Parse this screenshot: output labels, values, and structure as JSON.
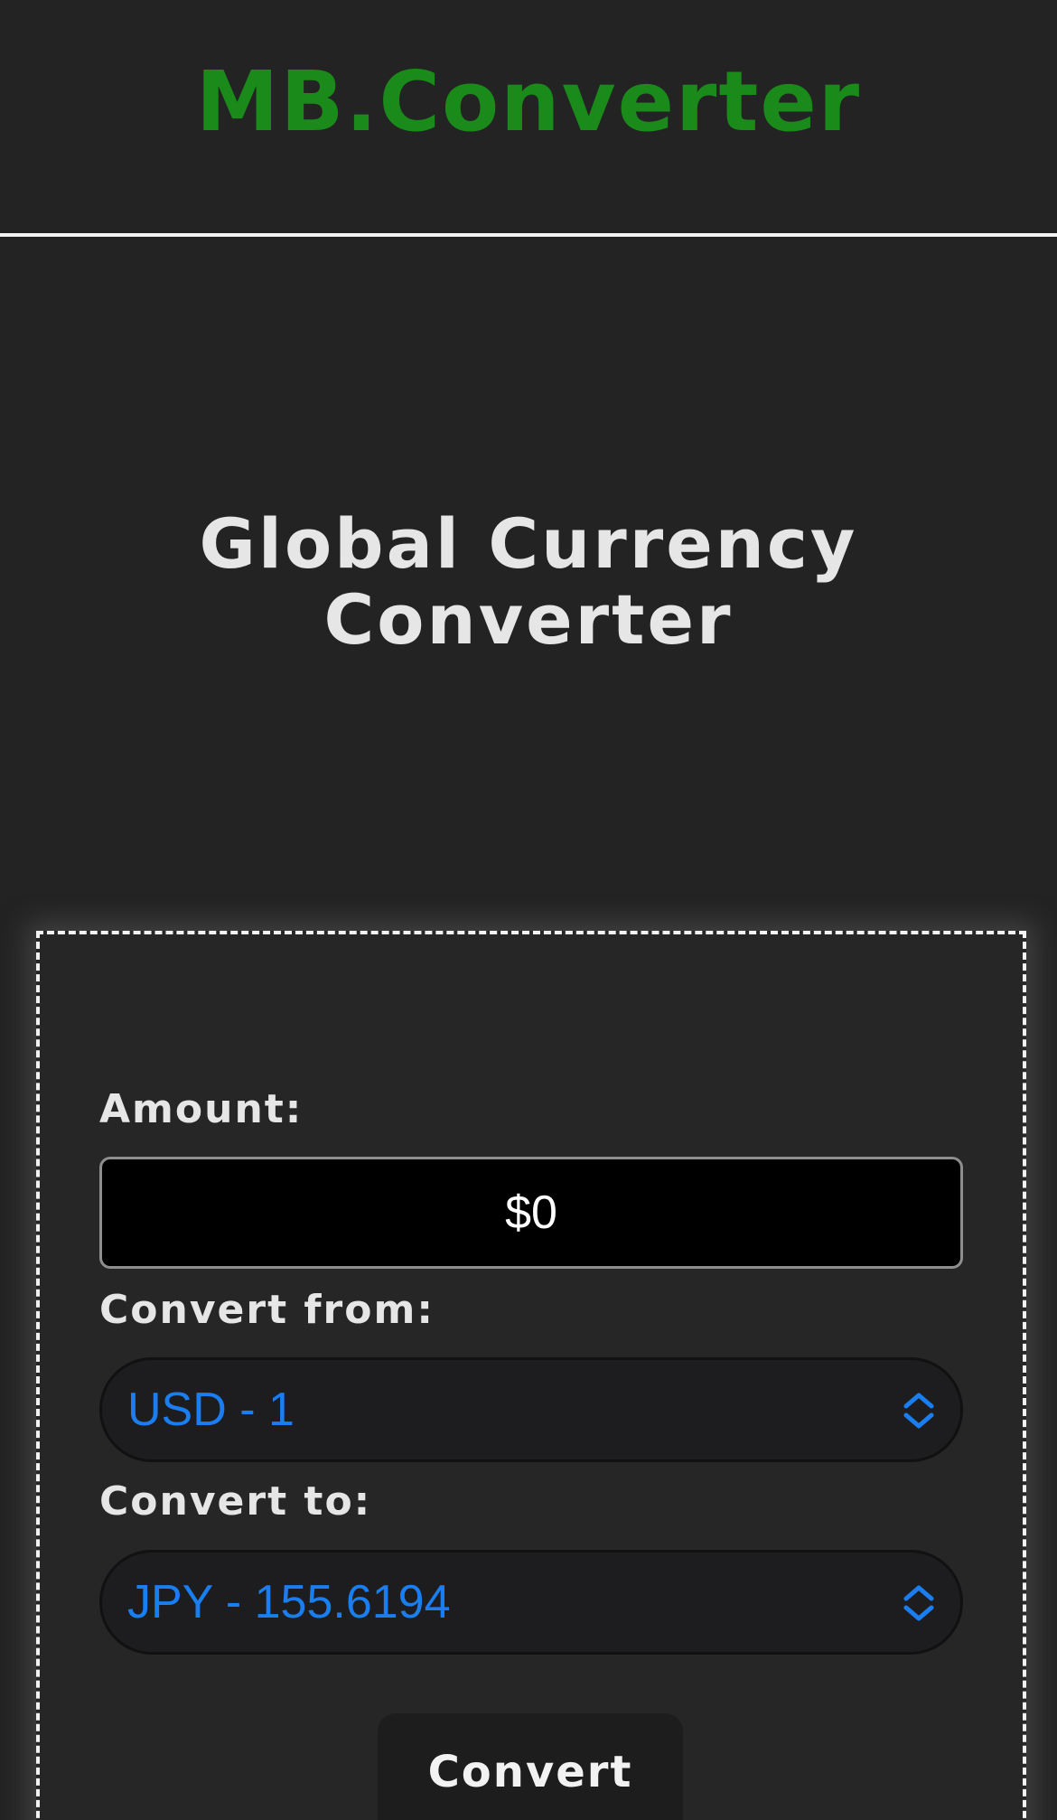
{
  "header": {
    "brand": "MB.Converter"
  },
  "hero": {
    "title_line1": "Global Currency",
    "title_line2": "Converter"
  },
  "form": {
    "amount_label": "Amount:",
    "amount_value": "$0",
    "from_label": "Convert from:",
    "from_value": "USD - 1",
    "to_label": "Convert to:",
    "to_value": "JPY - 155.6194",
    "convert_button": "Convert"
  },
  "colors": {
    "background": "#232324",
    "brand": "#1a8a1a",
    "select_text": "#1a7ef0",
    "text": "#e6e6e6"
  },
  "icons": {
    "select_indicator": "chevron-up-down-icon"
  }
}
